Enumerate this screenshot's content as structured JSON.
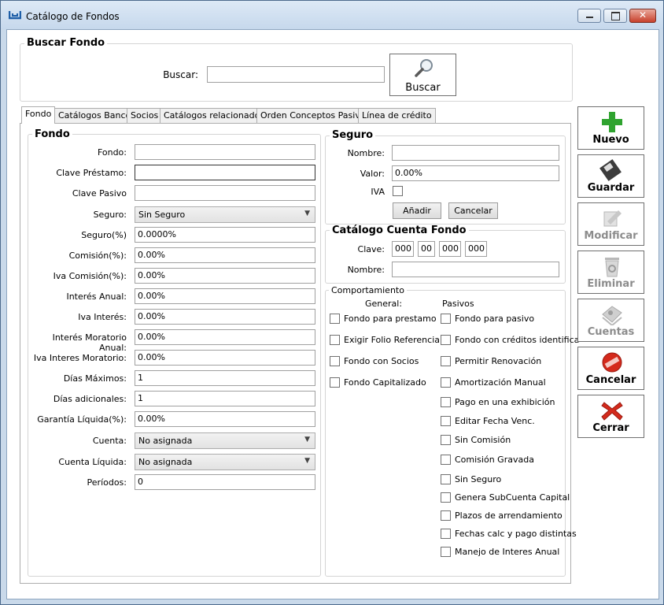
{
  "window": {
    "title": "Catálogo de Fondos"
  },
  "search": {
    "group_title": "Buscar Fondo",
    "label": "Buscar:",
    "value": "",
    "button": "Buscar"
  },
  "tabs": [
    "Fondo",
    "Catálogos Banco",
    "Socios",
    "Catálogos relacionados",
    "Orden Conceptos Pasivo",
    "Línea de crédito"
  ],
  "fondo": {
    "title": "Fondo",
    "fields": [
      {
        "label": "Fondo:",
        "value": ""
      },
      {
        "label": "Clave Préstamo:",
        "value": ""
      },
      {
        "label": "Clave Pasivo",
        "value": ""
      },
      {
        "label": "Seguro:",
        "value": "Sin Seguro",
        "combo": true
      },
      {
        "label": "Seguro(%)",
        "value": "0.0000%"
      },
      {
        "label": "Comisión(%):",
        "value": "0.00%"
      },
      {
        "label": "Iva Comisión(%):",
        "value": "0.00%"
      },
      {
        "label": "Interés Anual:",
        "value": "0.00%"
      },
      {
        "label": "Iva Interés:",
        "value": "0.00%"
      },
      {
        "label": "Interés Moratorio Anual:",
        "value": "0.00%"
      },
      {
        "label": "Iva Interes Moratorio:",
        "value": "0.00%"
      },
      {
        "label": "Días Máximos:",
        "value": "1"
      },
      {
        "label": "Días adicionales:",
        "value": "1"
      },
      {
        "label": "Garantía Líquida(%):",
        "value": "0.00%"
      },
      {
        "label": "Cuenta:",
        "value": "No asignada",
        "combo": true
      },
      {
        "label": "Cuenta Líquida:",
        "value": "No asignada",
        "combo": true
      },
      {
        "label": "Períodos:",
        "value": "0"
      }
    ]
  },
  "seguro": {
    "title": "Seguro",
    "nombre_label": "Nombre:",
    "nombre_value": "",
    "valor_label": "Valor:",
    "valor_value": "0.00%",
    "iva_label": "IVA",
    "add_button": "Añadir",
    "cancel_button": "Cancelar"
  },
  "cuenta_fondo": {
    "title": "Catálogo Cuenta Fondo",
    "clave_label": "Clave:",
    "clave_parts": [
      "000",
      "00",
      "000",
      "000"
    ],
    "nombre_label": "Nombre:",
    "nombre_value": ""
  },
  "comportamiento": {
    "title": "Comportamiento",
    "general_header": "General:",
    "pasivos_header": "Pasivos",
    "general": [
      "Fondo para prestamo",
      "Exigir Folio Referencia",
      "Fondo con Socios",
      "Fondo Capitalizado"
    ],
    "pasivos": [
      "Fondo para pasivo",
      "Fondo con créditos identifica",
      "Permitir Renovación",
      "Amortización Manual",
      "Pago en una exhibición",
      "Editar Fecha Venc.",
      "Sin Comisión",
      "Comisión Gravada",
      "Sin Seguro",
      "Genera SubCuenta Capital",
      "Plazos de arrendamiento",
      "Fechas calc y pago distintas",
      "Manejo de Interes Anual"
    ]
  },
  "actions": [
    {
      "label": "Nuevo",
      "icon": "plus-icon",
      "enabled": true
    },
    {
      "label": "Guardar",
      "icon": "floppy-disk-icon",
      "enabled": true
    },
    {
      "label": "Modificar",
      "icon": "edit-icon",
      "enabled": false
    },
    {
      "label": "Eliminar",
      "icon": "recycle-bin-icon",
      "enabled": false
    },
    {
      "label": "Cuentas",
      "icon": "book-icon",
      "enabled": false
    },
    {
      "label": "Cancelar",
      "icon": "cancel-circle-icon",
      "enabled": true
    },
    {
      "label": "Cerrar",
      "icon": "close-x-icon",
      "enabled": true
    }
  ],
  "colors": {
    "accent": "#1f5fa8",
    "green": "#2fa32f",
    "red": "#d42a1c",
    "disabled": "#8c8c8c"
  }
}
